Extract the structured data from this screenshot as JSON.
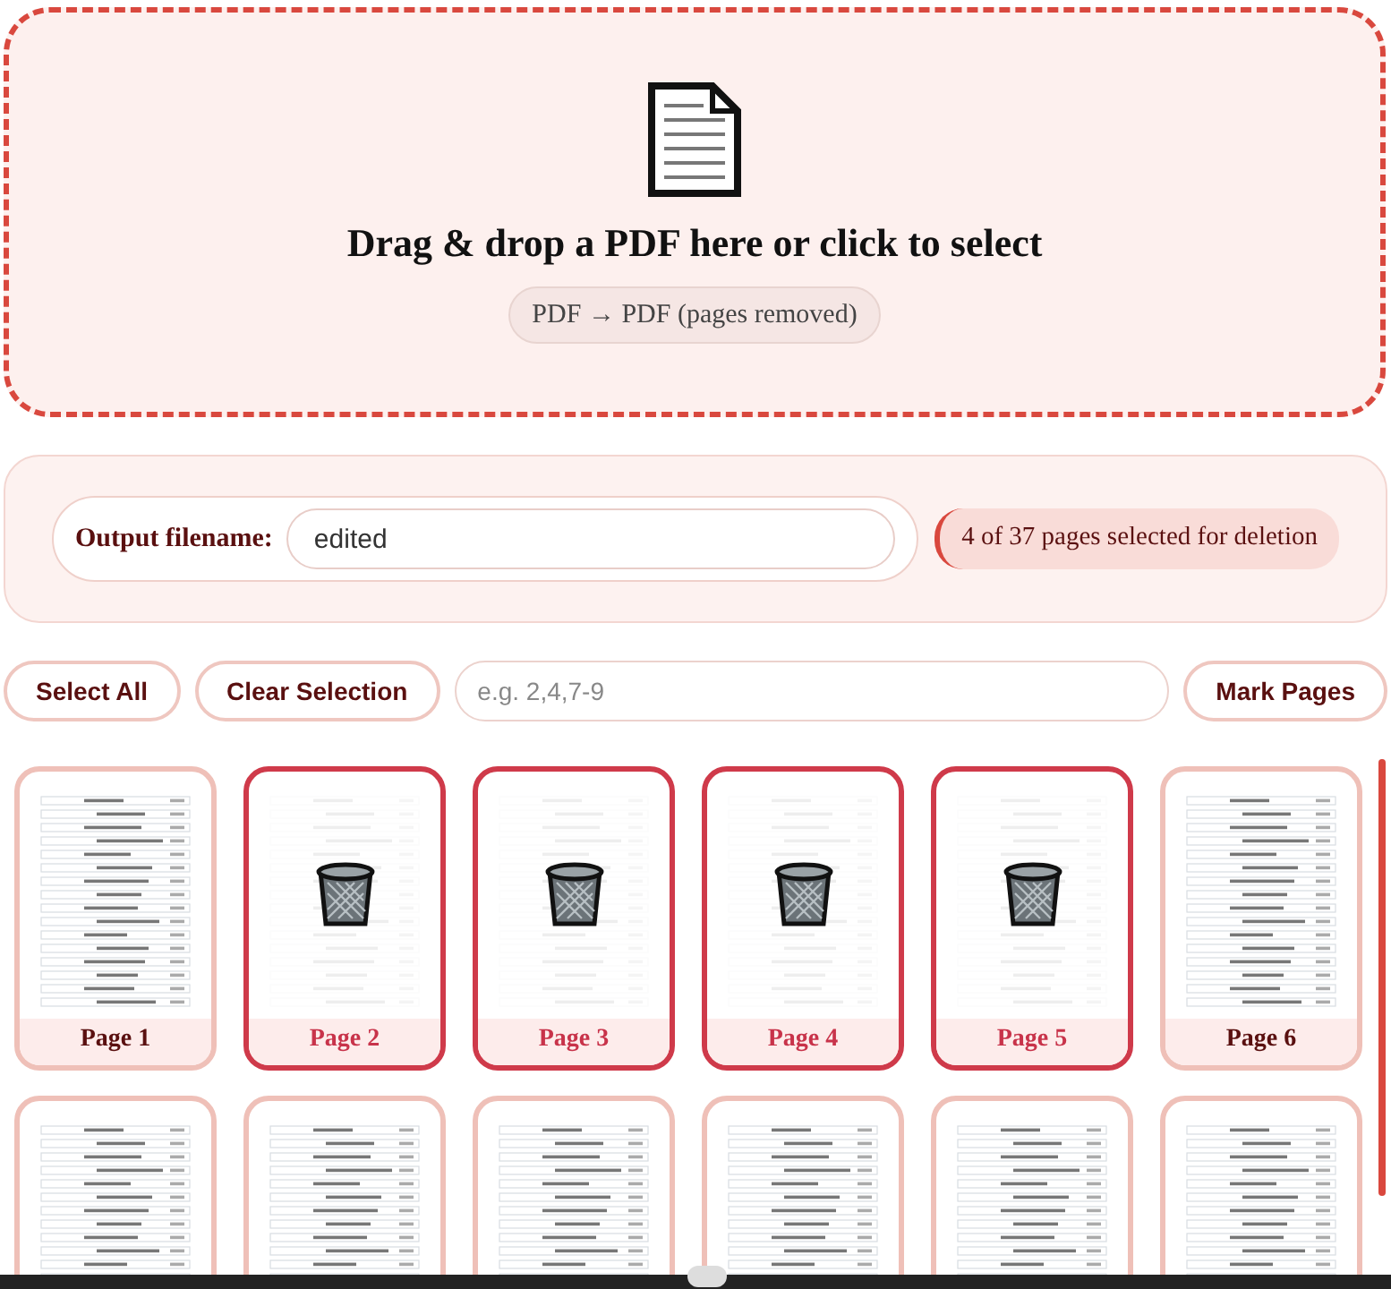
{
  "dropzone": {
    "title": "Drag & drop a PDF here or click to select",
    "mode": "PDF → PDF (pages removed)"
  },
  "output": {
    "label": "Output filename:",
    "value": "edited",
    "status": "4 of 37 pages selected for deletion"
  },
  "actions": {
    "select_all": "Select All",
    "clear": "Clear Selection",
    "range": {
      "placeholder": "e.g. 2,4,7-9"
    },
    "mark": "Mark Pages"
  },
  "pages": [
    {
      "label": "Page 1",
      "selected": false
    },
    {
      "label": "Page 2",
      "selected": true
    },
    {
      "label": "Page 3",
      "selected": true
    },
    {
      "label": "Page 4",
      "selected": true
    },
    {
      "label": "Page 5",
      "selected": true
    },
    {
      "label": "Page 6",
      "selected": false
    },
    {
      "selected": false
    },
    {
      "selected": false
    },
    {
      "selected": false
    },
    {
      "selected": false
    },
    {
      "selected": false
    },
    {
      "selected": false
    }
  ]
}
